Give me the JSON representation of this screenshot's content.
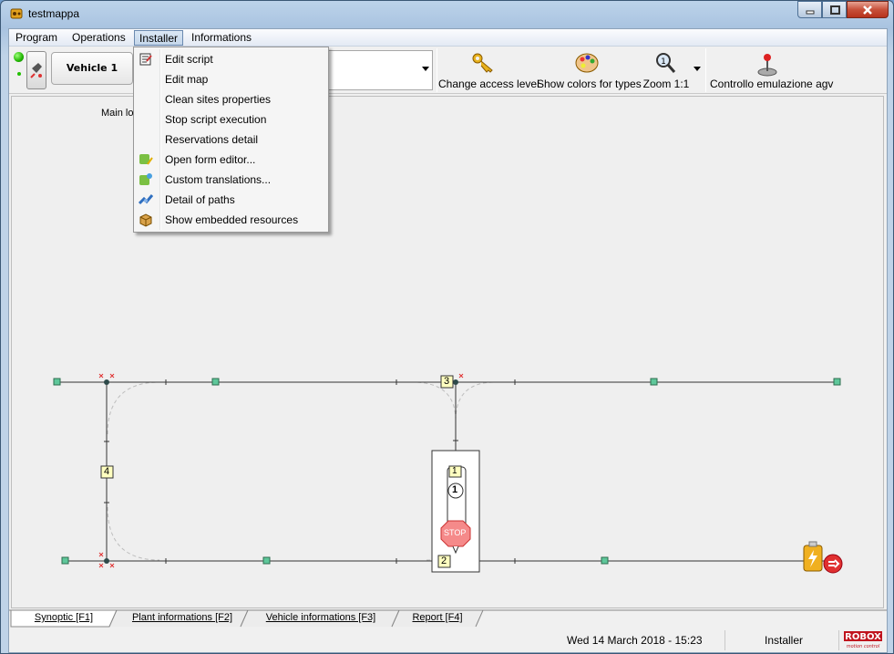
{
  "window": {
    "title": "testmappa"
  },
  "menubar": {
    "items": [
      "Program",
      "Operations",
      "Installer",
      "Informations"
    ],
    "open_index": 2
  },
  "toolbar": {
    "vehicle_label": "Vehicle 1",
    "change_access_level": "Change access level",
    "show_colors": "Show colors for types",
    "zoom": "Zoom 1:1",
    "controllo": "Controllo emulazione agv"
  },
  "installer_menu": {
    "items": [
      {
        "label": "Edit script",
        "icon": "edit-script-icon"
      },
      {
        "label": "Edit map",
        "icon": ""
      },
      {
        "label": "Clean sites properties",
        "icon": ""
      },
      {
        "label": "Stop script execution",
        "icon": ""
      },
      {
        "label": "Reservations detail",
        "icon": ""
      },
      {
        "label": "Open form editor...",
        "icon": "qt-form-icon"
      },
      {
        "label": "Custom translations...",
        "icon": "qt-translation-icon"
      },
      {
        "label": "Detail of paths",
        "icon": "paths-icon"
      },
      {
        "label": "Show embedded resources",
        "icon": "box-icon"
      }
    ]
  },
  "map": {
    "main_label": "Main lo",
    "node_labels": {
      "n1": "1",
      "n2": "2",
      "n3": "3",
      "n4": "4"
    },
    "vehicle_number": "1",
    "stop_text": "STOP"
  },
  "tabs": [
    "Synoptic [F1]",
    "Plant informations [F2]",
    "Vehicle informations [F3]",
    "Report [F4]"
  ],
  "status": {
    "datetime": "Wed 14 March 2018 - 15:23",
    "access_level": "Installer",
    "logo_text": "ROBOX",
    "logo_sub": "motion control"
  },
  "colors": {
    "accent": "#6b8ab0",
    "node": "#5ec79a",
    "label_bg": "#ffffc0"
  }
}
